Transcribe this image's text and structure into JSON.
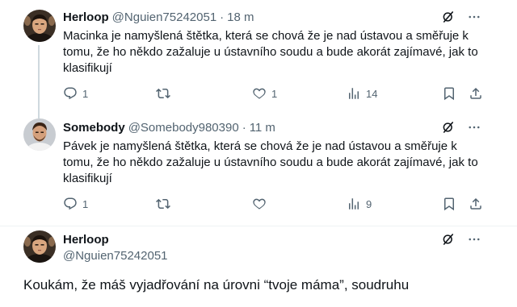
{
  "tweets": [
    {
      "name": "Herloop",
      "handle": "@Nguien75242051",
      "separator": "·",
      "time": "18 m",
      "text": "Macinka je namyšlená štětka, která se chová že je nad ústavou a směřuje k tomu, že ho někdo zažaluje u ústavního soudu a bude akorát zajímavé, jak to klasifikují",
      "replies": "1",
      "retweets": "",
      "likes": "1",
      "views": "14"
    },
    {
      "name": "Somebody",
      "handle": "@Somebody980390",
      "separator": "·",
      "time": "11 m",
      "text": "Pávek je namyšlená štětka, která se chová že je nad ústavou a směřuje k tomu, že ho někdo zažaluje u ústavního soudu a bude akorát zajímavé, jak to klasifikují",
      "replies": "1",
      "retweets": "",
      "likes": "",
      "views": "9"
    }
  ],
  "focused_tweet": {
    "name": "Herloop",
    "handle": "@Nguien75242051",
    "text": "Koukám, že máš vyjadřování na úrovni “tvoje máma”, soudruhu"
  },
  "icons": {
    "grok": "grok-icon",
    "more": "more-icon",
    "reply": "reply-icon",
    "retweet": "retweet-icon",
    "like": "like-icon",
    "views": "views-icon",
    "bookmark": "bookmark-icon",
    "share": "share-icon"
  },
  "colors": {
    "text": "#0f1419",
    "secondary": "#536471",
    "divider": "#eff3f4",
    "thread_line": "#cfd9de"
  }
}
